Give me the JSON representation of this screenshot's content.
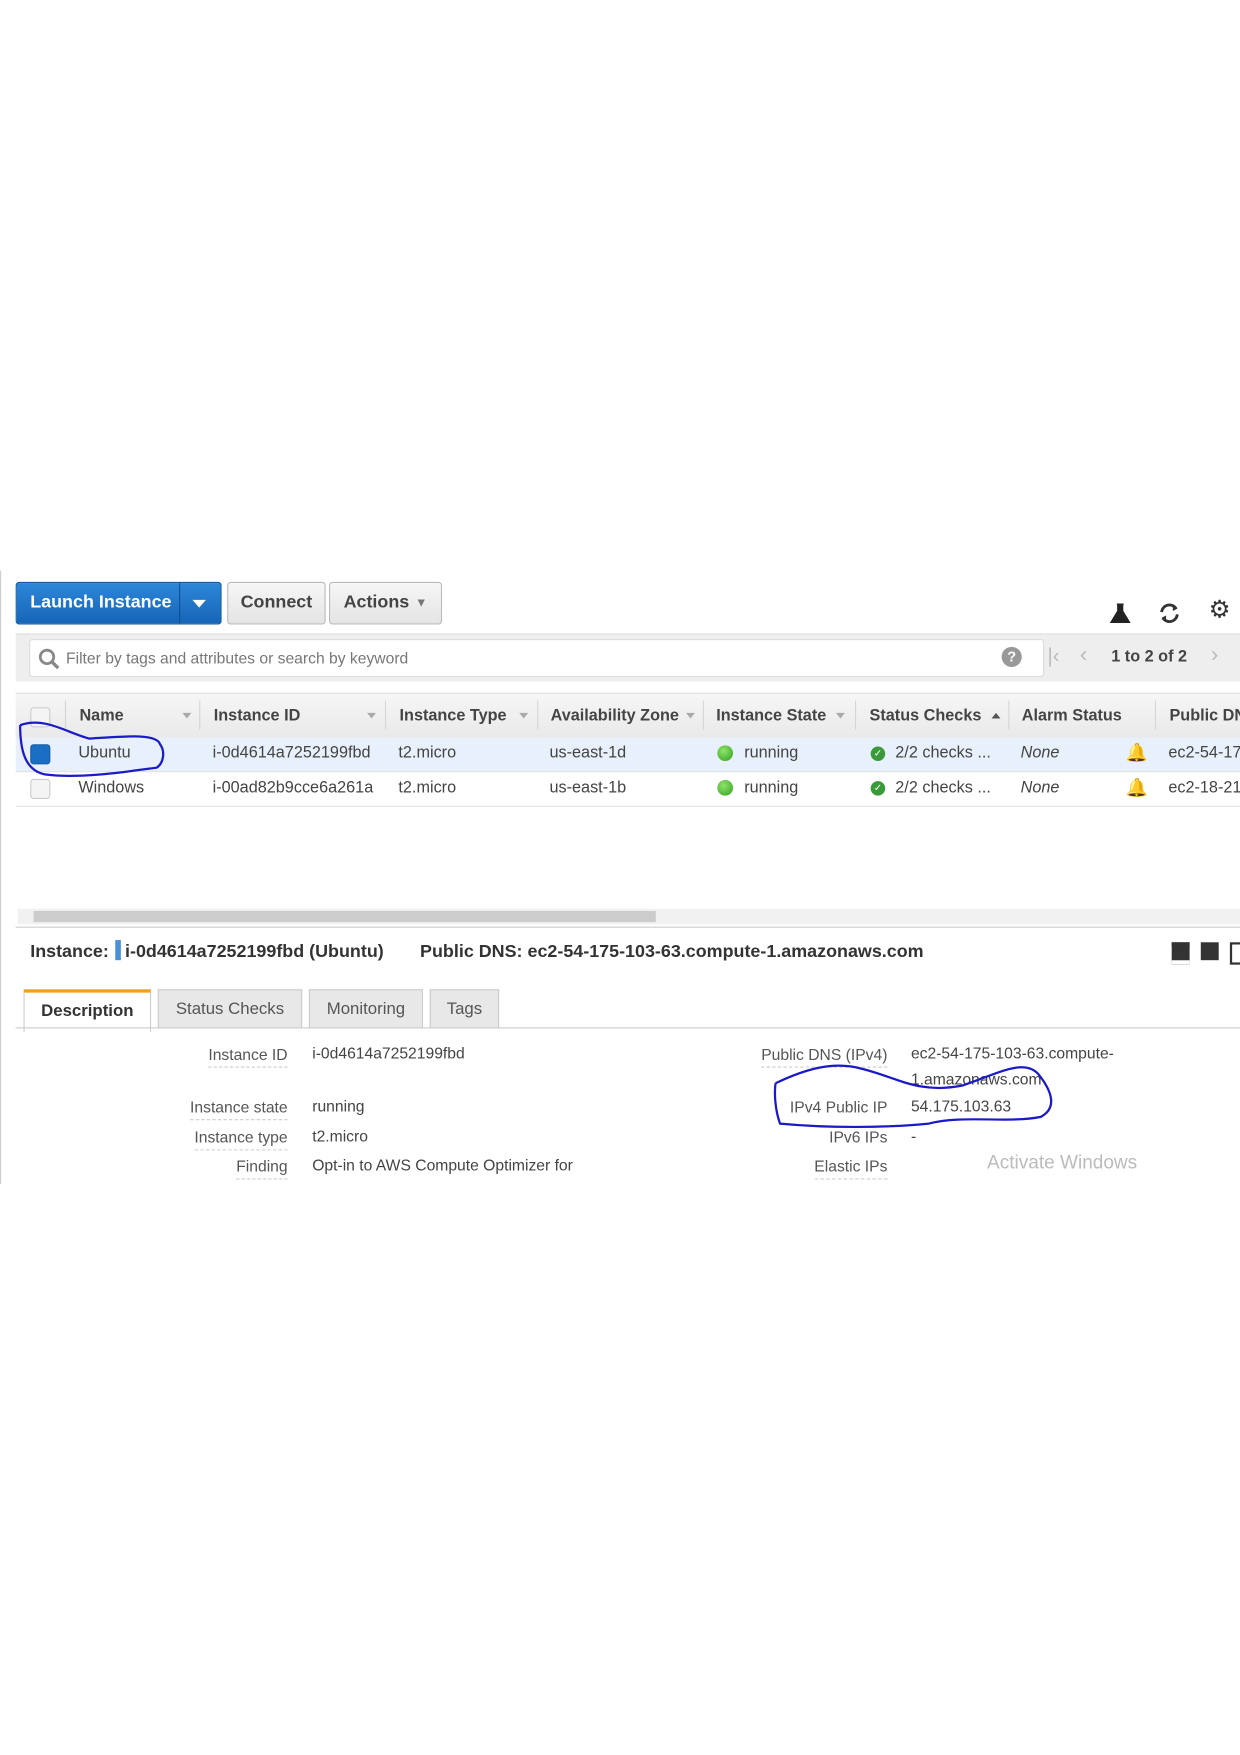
{
  "toolbar": {
    "launch_label": "Launch Instance",
    "connect_label": "Connect",
    "actions_label": "Actions"
  },
  "filter": {
    "placeholder": "Filter by tags and attributes or search by keyword",
    "pagination": "1 to 2 of 2"
  },
  "table": {
    "columns": [
      "Name",
      "Instance ID",
      "Instance Type",
      "Availability Zone",
      "Instance State",
      "Status Checks",
      "Alarm Status",
      "Public DN"
    ],
    "rows": [
      {
        "name": "Ubuntu",
        "id": "i-0d4614a7252199fbd",
        "type": "t2.micro",
        "az": "us-east-1d",
        "state": "running",
        "checks": "2/2 checks ...",
        "alarm": "None",
        "dns": "ec2-54-17",
        "selected": true
      },
      {
        "name": "Windows",
        "id": "i-00ad82b9cce6a261a",
        "type": "t2.micro",
        "az": "us-east-1b",
        "state": "running",
        "checks": "2/2 checks ...",
        "alarm": "None",
        "dns": "ec2-18-21",
        "selected": false
      }
    ]
  },
  "detail": {
    "instance_label": "Instance:",
    "instance_value": "i-0d4614a7252199fbd (Ubuntu)",
    "dns_label": "Public DNS:",
    "dns_value": "ec2-54-175-103-63.compute-1.amazonaws.com",
    "tabs": [
      "Description",
      "Status Checks",
      "Monitoring",
      "Tags"
    ],
    "left": [
      {
        "label": "Instance ID",
        "value": "i-0d4614a7252199fbd"
      },
      {
        "label": "Instance state",
        "value": "running"
      },
      {
        "label": "Instance type",
        "value": "t2.micro"
      },
      {
        "label": "Finding",
        "value": "Opt-in to AWS Compute Optimizer for"
      }
    ],
    "right": [
      {
        "label": "Public DNS (IPv4)",
        "value": "ec2-54-175-103-63.compute-",
        "value2": "1.amazonaws.com"
      },
      {
        "label": "IPv4 Public IP",
        "value": "54.175.103.63"
      },
      {
        "label": "IPv6 IPs",
        "value": "-"
      },
      {
        "label": "Elastic IPs",
        "value": ""
      }
    ]
  },
  "watermark": "Activate Windows",
  "colors": {
    "primary": "#1a6fc4",
    "tab_accent": "#f0a020",
    "ink": "#1a1ac8"
  }
}
